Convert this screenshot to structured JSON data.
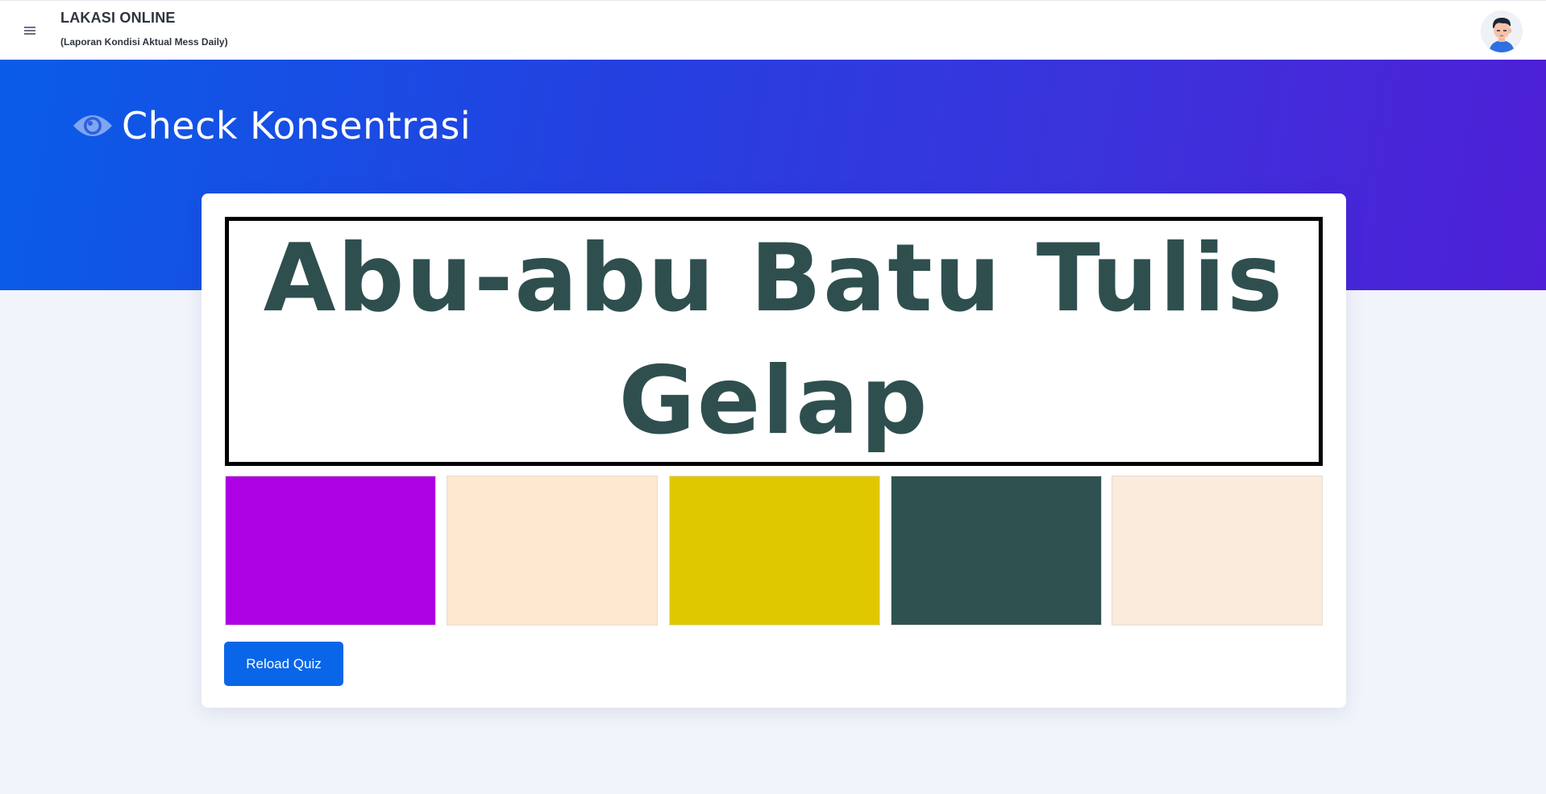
{
  "header": {
    "app_title": "LAKASI ONLINE",
    "app_subtitle": "(Laporan Kondisi Aktual Mess Daily)",
    "menu_icon": "hamburger-menu-icon",
    "avatar_icon": "user-avatar"
  },
  "hero": {
    "gradient_colors": [
      "#0a5ce8",
      "#4f1fd6"
    ],
    "page_title": "Check Konsentrasi",
    "title_icon": "eye-icon"
  },
  "quiz": {
    "word_line1": "Abu-abu Batu Tulis",
    "word_line2": "Gelap",
    "word_color": "#2f4f4f",
    "options": [
      {
        "color": "#ad00e3"
      },
      {
        "color": "#fde8d0"
      },
      {
        "color": "#e0c800"
      },
      {
        "color": "#2f5150"
      },
      {
        "color": "#faebdc"
      }
    ],
    "reload_label": "Reload Quiz"
  },
  "colors": {
    "accent": "#0a66e8",
    "page_background": "#f1f4fb"
  }
}
